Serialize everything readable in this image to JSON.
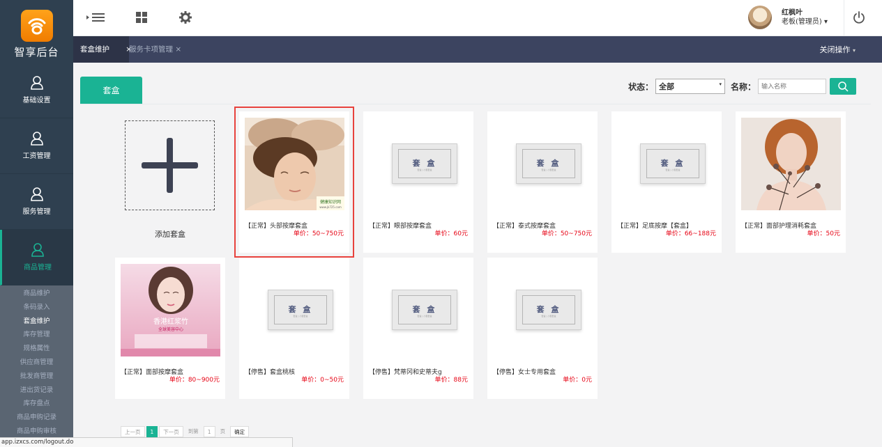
{
  "app": {
    "logo_text": "智享后台",
    "accent": "#1ab394",
    "sidebar_bg": "#2f4050"
  },
  "sidebar": {
    "items": [
      {
        "label": "基础设置",
        "icon": "user-icon"
      },
      {
        "label": "工资管理",
        "icon": "user-icon"
      },
      {
        "label": "服务管理",
        "icon": "user-icon"
      },
      {
        "label": "商品管理",
        "icon": "user-icon",
        "active": true
      }
    ],
    "submenu": [
      "商品维护",
      "条码录入",
      "套盒维护",
      "库存管理",
      "规格属性",
      "供应商管理",
      "批发商管理",
      "进出货记录",
      "库存盘点",
      "商品申购记录",
      "商品申购审核"
    ],
    "submenu_current": "套盒维护"
  },
  "header": {
    "user_name": "红枫叶",
    "user_role": "老板(管理员)",
    "role_caret": "▾"
  },
  "tabs": {
    "active": "套盒维护",
    "active_close": "×",
    "inactive": "服务卡项管理",
    "inactive_close": "×",
    "close_ops": "关闭操作",
    "close_ops_caret": "▾"
  },
  "content": {
    "panel_tab": "套盒",
    "filter": {
      "status_label": "状态：",
      "status_value": "全部",
      "status_caret": "▾",
      "name_label": "名称：",
      "name_placeholder": "输入名称"
    },
    "add_label": "添加套盒",
    "cards": [
      {
        "name": "【正常】头部按摩套盒",
        "price": "单价：50~750元",
        "image": "photo-head-massage"
      },
      {
        "name": "【正常】眼部按摩套盒",
        "price": "单价：60元",
        "image": "box"
      },
      {
        "name": "【正常】泰式按摩套盒",
        "price": "单价：50~750元",
        "image": "box"
      },
      {
        "name": "【正常】足底按摩【套盒】",
        "price": "单价：66~188元",
        "image": "box"
      },
      {
        "name": "【正常】面部护理消耗套盒",
        "price": "单价：50元",
        "image": "photo-woman-flowers"
      },
      {
        "name": "【正常】面部按摩套盒",
        "price": "单价：80~900元",
        "image": "photo-poster"
      },
      {
        "name": "【停售】套盒桃核",
        "price": "单价：0~50元",
        "image": "box"
      },
      {
        "name": "【停售】梵蒂冈和史蒂夫g",
        "price": "单价：88元",
        "image": "box"
      },
      {
        "name": "【停售】女士专用套盒",
        "price": "单价：0元",
        "image": "box"
      }
    ],
    "box_title": "套 盒",
    "box_subtitle": "套盒 | 小型套盒",
    "image_watermark": "健康知识网",
    "image_watermark_url": "www.jk725.com",
    "poster_text_1": "香港红浆竹",
    "poster_text_2": "全球美容中心"
  },
  "pager": {
    "prev": "上一页",
    "current": "1",
    "next": "下一页",
    "goto": "到第",
    "page_input": "1",
    "page_unit": "页",
    "confirm": "确定"
  },
  "statusbar": {
    "url": "app.izxcs.com/logout.do"
  }
}
